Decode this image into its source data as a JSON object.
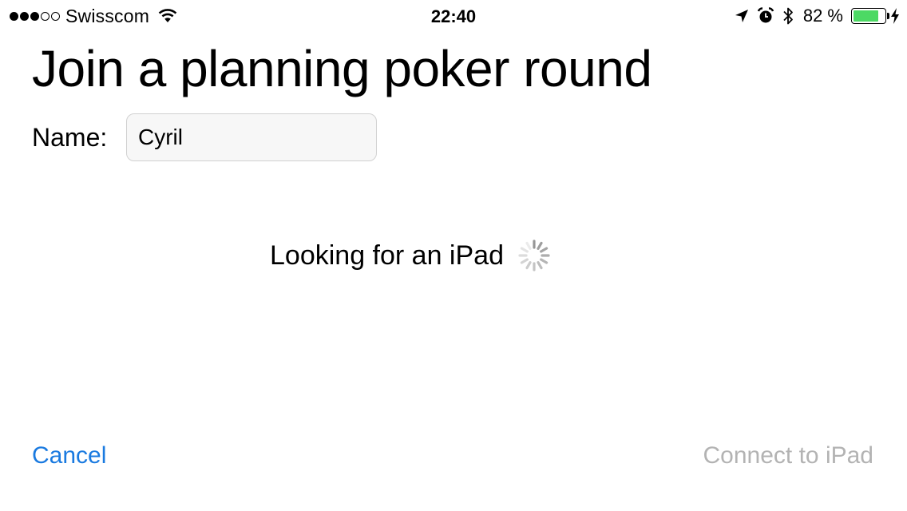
{
  "status_bar": {
    "signal_bars_filled": 3,
    "signal_bars_total": 5,
    "carrier": "Swisscom",
    "time": "22:40",
    "battery_percent_label": "82 %",
    "battery_level": 0.82,
    "battery_color": "#4cd964",
    "icons": [
      "wifi-icon",
      "location-arrow-icon",
      "alarm-icon",
      "bluetooth-icon",
      "battery-icon",
      "charging-bolt-icon"
    ]
  },
  "main": {
    "title": "Join a planning poker round",
    "name_label": "Name:",
    "name_value": "Cyril",
    "searching_text": "Looking for an iPad",
    "spinner_icon": "activity-spinner-icon"
  },
  "actions": {
    "cancel_label": "Cancel",
    "connect_label": "Connect to iPad",
    "accent_color": "#1a7ae0",
    "disabled_color": "#b3b3b3"
  }
}
